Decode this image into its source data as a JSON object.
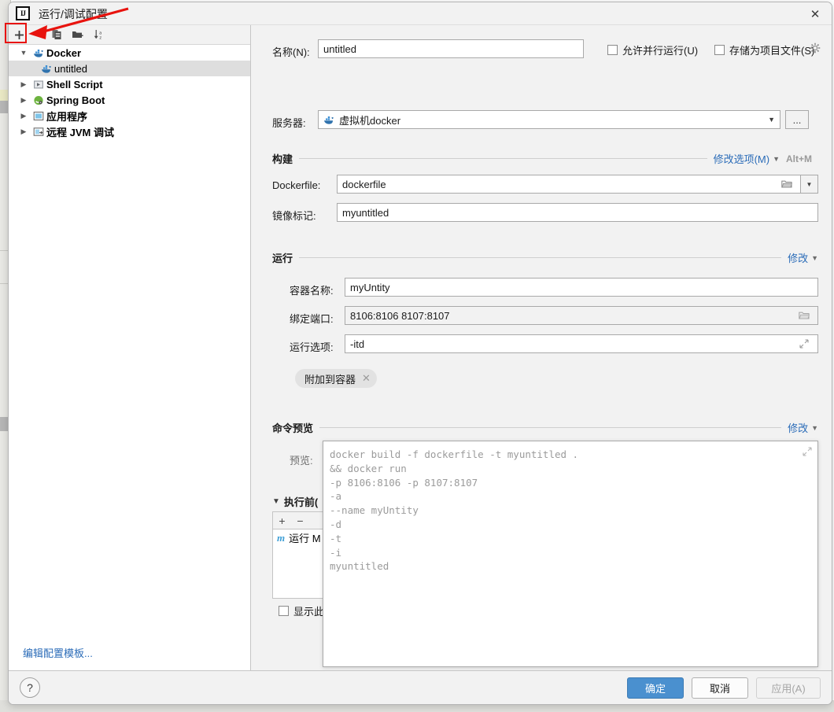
{
  "window": {
    "title": "运行/调试配置",
    "logo_text": "IJ",
    "close_icon": "close-icon"
  },
  "sidebar": {
    "toolbar": [
      {
        "name": "add-configuration-button",
        "glyph": "+",
        "label": "添加"
      },
      {
        "name": "copy-configuration-button",
        "glyph": "❐",
        "label": "复制"
      },
      {
        "name": "new-folder-button",
        "glyph": "▰",
        "label": "新建文件夹"
      },
      {
        "name": "sort-configurations-button",
        "glyph": "↓",
        "label": "排序"
      }
    ],
    "tree": [
      {
        "name": "tree-node-docker",
        "label": "Docker",
        "arrow": "expanded",
        "icon": "docker-icon",
        "indent": 0,
        "bold": true,
        "selected": false
      },
      {
        "name": "tree-node-untitled",
        "label": "untitled",
        "arrow": "none",
        "icon": "docker-icon",
        "indent": 1,
        "bold": false,
        "selected": true
      },
      {
        "name": "tree-node-shell-script",
        "label": "Shell Script",
        "arrow": "collapsed",
        "icon": "shell-icon",
        "indent": 0,
        "bold": true,
        "selected": false
      },
      {
        "name": "tree-node-spring-boot",
        "label": "Spring Boot",
        "arrow": "collapsed",
        "icon": "spring-icon",
        "indent": 0,
        "bold": true,
        "selected": false
      },
      {
        "name": "tree-node-application",
        "label": "应用程序",
        "arrow": "collapsed",
        "icon": "application-icon",
        "indent": 0,
        "bold": true,
        "selected": false
      },
      {
        "name": "tree-node-remote-jvm-debug",
        "label": "远程 JVM 调试",
        "arrow": "collapsed",
        "icon": "remote-debug-icon",
        "indent": 0,
        "bold": true,
        "selected": false
      }
    ],
    "edit_templates_link": "编辑配置模板..."
  },
  "form": {
    "name_label": "名称(N):",
    "name_label_mnemonic": "N",
    "name_value": "untitled",
    "allow_parallel_label": "允许并行运行(U)",
    "allow_parallel_checked": false,
    "store_as_project_file_label": "存储为项目文件(S)",
    "store_as_project_file_checked": false,
    "gear_icon": "gear-icon",
    "server_label": "服务器:",
    "server_value": "虚拟机docker",
    "server_icon": "docker-icon",
    "server_more_button": "...",
    "build_section": {
      "title": "构建",
      "modify_options_link": "修改选项(M)",
      "shortcut": "Alt+M",
      "dockerfile_label": "Dockerfile:",
      "dockerfile_value": "dockerfile",
      "dockerfile_browse_icon": "folder-icon",
      "image_tag_label": "镜像标记:",
      "image_tag_value": "myuntitled"
    },
    "run_section": {
      "title": "运行",
      "modify_link": "修改",
      "container_name_label": "容器名称:",
      "container_name_value": "myUntity",
      "bind_ports_label": "绑定端口:",
      "bind_ports_value": "8106:8106 8107:8107",
      "bind_ports_browse_icon": "folder-icon",
      "run_options_label": "运行选项:",
      "run_options_value": "-itd",
      "run_options_expand_icon": "expand-icon",
      "attach_chip_label": "附加到容器",
      "attach_chip_close_icon": "close-icon"
    },
    "command_preview_section": {
      "title": "命令预览",
      "modify_link": "修改",
      "preview_label": "预览:",
      "preview_text": "docker build -f dockerfile -t myuntitled .\n&& docker run\n-p 8106:8106 -p 8107:8107\n-a\n--name myUntity\n-d\n-t\n-i\nmyuntitled",
      "expand_icon": "expand-icon"
    },
    "before_launch_section": {
      "title": "执行前(",
      "add_button": "+",
      "remove_button": "−",
      "items": [
        {
          "icon": "maven-icon",
          "icon_text": "m",
          "label": "运行 M"
        }
      ],
      "show_checkbox_label": "显示此",
      "show_checkbox_checked": false
    }
  },
  "footer": {
    "help_button": "?",
    "ok_button": "确定",
    "cancel_button": "取消",
    "apply_button": "应用(A)"
  },
  "colors": {
    "accent_blue": "#4a90cf",
    "link_blue": "#2b6cb8",
    "annotation_red": "#e8130e",
    "selection_gray": "#dedede"
  }
}
